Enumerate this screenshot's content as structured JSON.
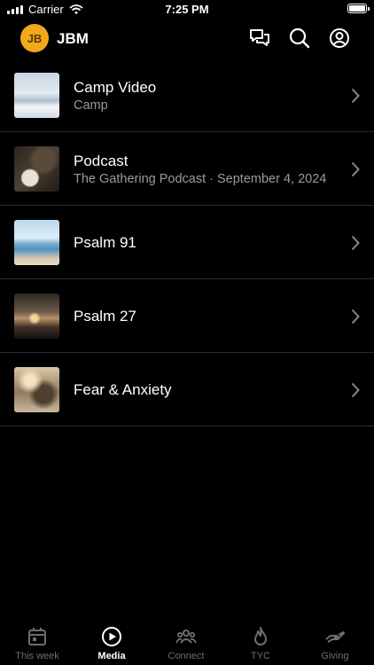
{
  "status_bar": {
    "carrier": "Carrier",
    "time": "7:25 PM"
  },
  "header": {
    "logo_text": "JB",
    "brand": "JBM",
    "icons": [
      "chat-icon",
      "search-icon",
      "account-icon"
    ]
  },
  "media_items": [
    {
      "title": "Camp Video",
      "subtitle": "Camp"
    },
    {
      "title": "Podcast",
      "subtitle": "The Gathering Podcast · September 4, 2024"
    },
    {
      "title": "Psalm 91",
      "subtitle": ""
    },
    {
      "title": "Psalm 27",
      "subtitle": ""
    },
    {
      "title": "Fear & Anxiety",
      "subtitle": ""
    }
  ],
  "tabs": [
    {
      "label": "This week",
      "icon": "calendar-icon",
      "active": false
    },
    {
      "label": "Media",
      "icon": "play-icon",
      "active": true
    },
    {
      "label": "Connect",
      "icon": "people-icon",
      "active": false
    },
    {
      "label": "TYC",
      "icon": "flame-icon",
      "active": false
    },
    {
      "label": "Giving",
      "icon": "giving-hand-icon",
      "active": false
    }
  ],
  "colors": {
    "background": "#000000",
    "accent": "#f2a81d",
    "muted_text": "#9a9a9a",
    "inactive_tab": "#6e6e6e"
  }
}
